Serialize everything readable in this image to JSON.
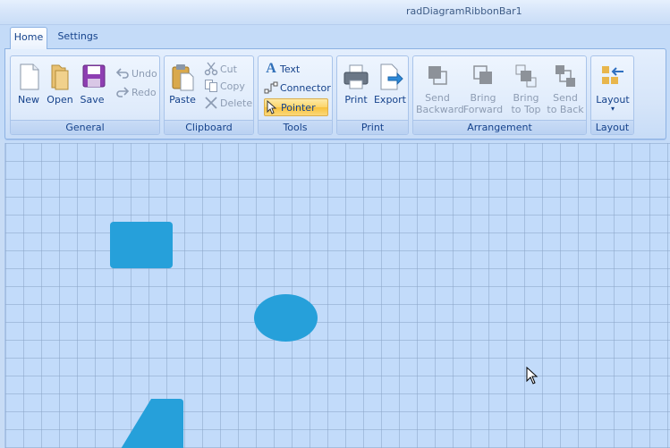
{
  "window": {
    "title": "radDiagramRibbonBar1"
  },
  "tabs": [
    {
      "label": "Home",
      "selected": true
    },
    {
      "label": "Settings",
      "selected": false
    }
  ],
  "groups": {
    "general": {
      "label": "General",
      "new_label": "New",
      "open_label": "Open",
      "save_label": "Save",
      "undo_label": "Undo",
      "redo_label": "Redo"
    },
    "clipboard": {
      "label": "Clipboard",
      "paste_label": "Paste",
      "cut_label": "Cut",
      "copy_label": "Copy",
      "delete_label": "Delete"
    },
    "tools": {
      "label": "Tools",
      "text_label": "Text",
      "connector_label": "Connector",
      "pointer_label": "Pointer",
      "selected_tool": "Pointer"
    },
    "print": {
      "label": "Print",
      "print_label": "Print",
      "export_label": "Export"
    },
    "arrangement": {
      "label": "Arrangement",
      "send_backward": [
        "Send",
        "Backward"
      ],
      "bring_forward": [
        "Bring",
        "Forward"
      ],
      "bring_to_top": [
        "Bring",
        "to Top"
      ],
      "send_to_back": [
        "Send",
        "to Back"
      ]
    },
    "layout": {
      "label": "Layout",
      "layout_label": "Layout"
    }
  },
  "canvas": {
    "shapes": [
      {
        "type": "rectangle",
        "color": "#26a0da"
      },
      {
        "type": "ellipse",
        "color": "#26a0da"
      },
      {
        "type": "parallelogram",
        "color": "#26a0da"
      }
    ]
  },
  "colors": {
    "accent": "#26a0da",
    "ribbon_text": "#15428b",
    "selected_tool": "#fbd56a",
    "canvas_bg": "#c2dbfa"
  }
}
